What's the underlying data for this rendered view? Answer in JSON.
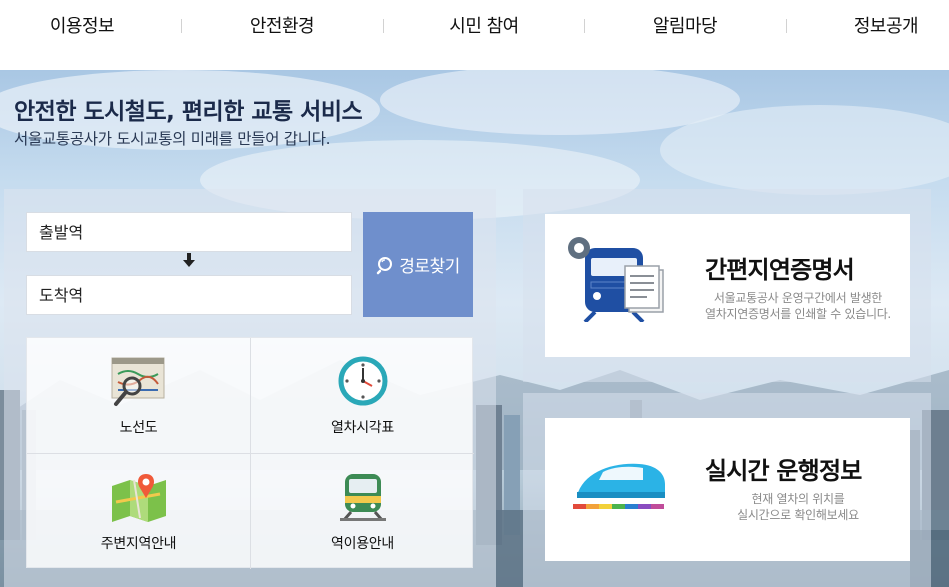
{
  "nav": {
    "items": [
      "이용정보",
      "안전환경",
      "시민 참여",
      "알림마당",
      "정보공개"
    ]
  },
  "hero": {
    "headline": "안전한 도시철도, 편리한 교통 서비스",
    "subline": "서울교통공사가 도시교통의 미래를 만들어 갑니다."
  },
  "route": {
    "departure_placeholder": "출발역",
    "arrival_placeholder": "도착역",
    "search_label": "경로찾기"
  },
  "quick_links": [
    {
      "label": "노선도",
      "icon": "route-map-icon"
    },
    {
      "label": "열차시각표",
      "icon": "clock-icon"
    },
    {
      "label": "주변지역안내",
      "icon": "map-pin-icon"
    },
    {
      "label": "역이용안내",
      "icon": "train-front-icon"
    }
  ],
  "cards": {
    "delay": {
      "title": "간편지연증명서",
      "desc_line1": "서울교통공사 운영구간에서 발생한",
      "desc_line2": "열차지연증명서를 인쇄할 수 있습니다.",
      "icon": "train-document-icon"
    },
    "realtime": {
      "title": "실시간 운행정보",
      "desc_line1": "현재 열차의 위치를",
      "desc_line2": "실시간으로 확인해보세요",
      "icon": "bullet-train-icon"
    }
  },
  "colors": {
    "route_button": "#6f8fcc",
    "headline": "#1b2a4a",
    "train_blue": "#1f4fa3"
  }
}
